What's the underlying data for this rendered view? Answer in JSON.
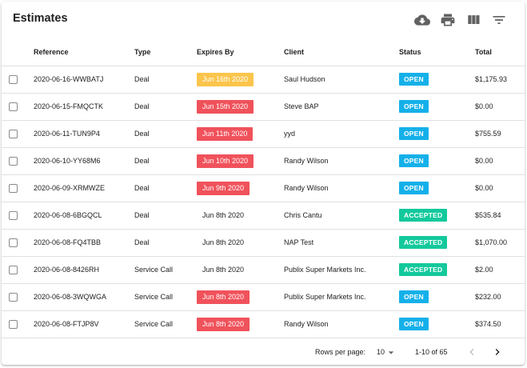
{
  "header": {
    "title": "Estimates"
  },
  "toolbar": {
    "icons": [
      "cloud-download-icon",
      "print-icon",
      "view-column-icon",
      "filter-list-icon"
    ]
  },
  "columns": {
    "reference": "Reference",
    "type": "Type",
    "expires": "Expires By",
    "client": "Client",
    "status": "Status",
    "total": "Total"
  },
  "rows": [
    {
      "reference": "2020-06-16-WWBATJ",
      "type": "Deal",
      "expires": "Jun 16th 2020",
      "expires_state": "warning",
      "client": "Saul Hudson",
      "status": "OPEN",
      "total": "$1,175.93"
    },
    {
      "reference": "2020-06-15-FMQCTK",
      "type": "Deal",
      "expires": "Jun 15th 2020",
      "expires_state": "expired",
      "client": "Steve BAP",
      "status": "OPEN",
      "total": "$0.00"
    },
    {
      "reference": "2020-06-11-TUN9P4",
      "type": "Deal",
      "expires": "Jun 11th 2020",
      "expires_state": "expired",
      "client": "yyd",
      "status": "OPEN",
      "total": "$755.59"
    },
    {
      "reference": "2020-06-10-YY68M6",
      "type": "Deal",
      "expires": "Jun 10th 2020",
      "expires_state": "expired",
      "client": "Randy Wilson",
      "status": "OPEN",
      "total": "$0.00"
    },
    {
      "reference": "2020-06-09-XRMWZE",
      "type": "Deal",
      "expires": "Jun 9th 2020",
      "expires_state": "expired",
      "client": "Randy Wilson",
      "status": "OPEN",
      "total": "$0.00"
    },
    {
      "reference": "2020-06-08-6BGQCL",
      "type": "Deal",
      "expires": "Jun 8th 2020",
      "expires_state": "none",
      "client": "Chris Cantu",
      "status": "ACCEPTED",
      "total": "$535.84"
    },
    {
      "reference": "2020-06-08-FQ4TBB",
      "type": "Deal",
      "expires": "Jun 8th 2020",
      "expires_state": "none",
      "client": "NAP Test",
      "status": "ACCEPTED",
      "total": "$1,070.00"
    },
    {
      "reference": "2020-06-08-8426RH",
      "type": "Service Call",
      "expires": "Jun 8th 2020",
      "expires_state": "none",
      "client": "Publix Super Markets Inc.",
      "status": "ACCEPTED",
      "total": "$2.00"
    },
    {
      "reference": "2020-06-08-3WQWGA",
      "type": "Service Call",
      "expires": "Jun 8th 2020",
      "expires_state": "expired",
      "client": "Publix Super Markets Inc.",
      "status": "OPEN",
      "total": "$232.00"
    },
    {
      "reference": "2020-06-08-FTJP8V",
      "type": "Service Call",
      "expires": "Jun 8th 2020",
      "expires_state": "expired",
      "client": "Randy Wilson",
      "status": "OPEN",
      "total": "$374.50"
    }
  ],
  "footer": {
    "rows_per_page_label": "Rows per page:",
    "rows_per_page_value": "10",
    "range": "1-10 of 65"
  },
  "colors": {
    "warning": "#fbc54c",
    "expired": "#f0525b",
    "open": "#14b0e9",
    "accepted": "#13c99c"
  }
}
